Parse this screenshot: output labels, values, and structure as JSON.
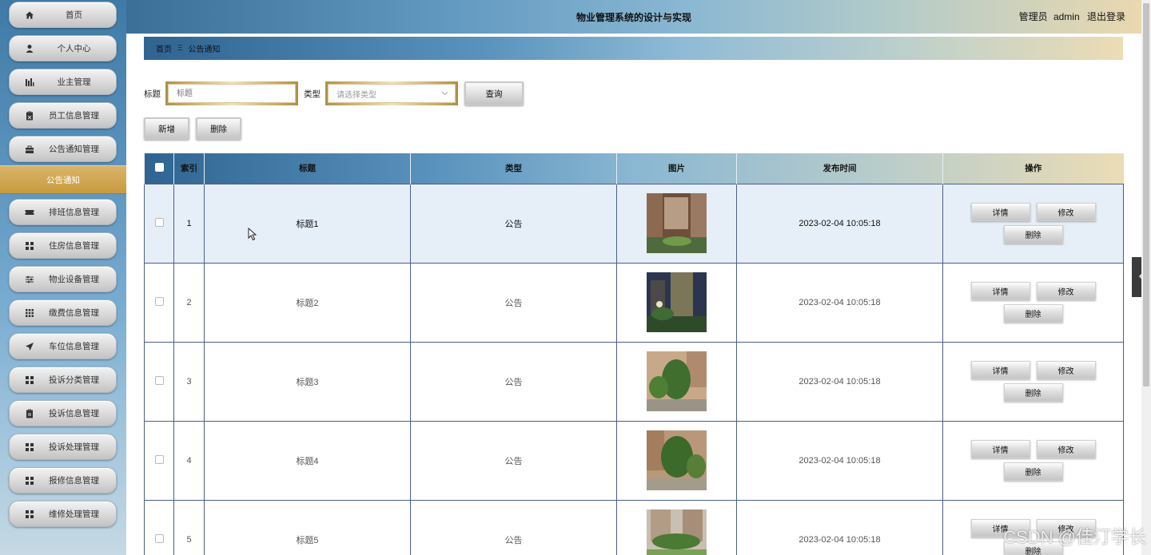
{
  "sidebar": {
    "items": [
      {
        "label": "首页",
        "icon": "home-icon"
      },
      {
        "label": "个人中心",
        "icon": "user-icon"
      },
      {
        "label": "业主管理",
        "icon": "chart-icon"
      },
      {
        "label": "员工信息管理",
        "icon": "clipboard-icon"
      },
      {
        "label": "公告通知管理",
        "icon": "briefcase-icon"
      },
      {
        "label": "排班信息管理",
        "icon": "ticket-icon"
      },
      {
        "label": "住房信息管理",
        "icon": "grid-icon"
      },
      {
        "label": "物业设备管理",
        "icon": "sliders-icon"
      },
      {
        "label": "缴费信息管理",
        "icon": "grid-dots-icon"
      },
      {
        "label": "车位信息管理",
        "icon": "send-icon"
      },
      {
        "label": "投诉分类管理",
        "icon": "grid-icon"
      },
      {
        "label": "投诉信息管理",
        "icon": "clipboard-icon"
      },
      {
        "label": "投诉处理管理",
        "icon": "grid-icon"
      },
      {
        "label": "报修信息管理",
        "icon": "grid-icon"
      },
      {
        "label": "维修处理管理",
        "icon": "grid-icon"
      }
    ],
    "active_sub": "公告通知"
  },
  "header": {
    "title": "物业管理系统的设计与实现",
    "role": "管理员",
    "username": "admin",
    "logout": "退出登录"
  },
  "breadcrumb": {
    "home": "首页",
    "current": "公告通知"
  },
  "search": {
    "title_label": "标题",
    "title_placeholder": "标题",
    "type_label": "类型",
    "type_placeholder": "请选择类型",
    "query_button": "查询"
  },
  "actions": {
    "add": "新增",
    "delete": "删除"
  },
  "table": {
    "headers": [
      "索引",
      "标题",
      "类型",
      "图片",
      "发布时间",
      "操作"
    ],
    "rows": [
      {
        "index": "1",
        "title": "标题1",
        "type": "公告",
        "time": "2023-02-04 10:05:18"
      },
      {
        "index": "2",
        "title": "标题2",
        "type": "公告",
        "time": "2023-02-04 10:05:18"
      },
      {
        "index": "3",
        "title": "标题3",
        "type": "公告",
        "time": "2023-02-04 10:05:18"
      },
      {
        "index": "4",
        "title": "标题4",
        "type": "公告",
        "time": "2023-02-04 10:05:18"
      },
      {
        "index": "5",
        "title": "标题5",
        "type": "公告",
        "time": "2023-02-04 10:05:18"
      }
    ],
    "op_detail": "详情",
    "op_edit": "修改",
    "op_delete": "删除"
  },
  "watermark": "CSDN @佳汀学长",
  "colors": {
    "accent_blue": "#3b6f98",
    "gold": "#c89a3f",
    "row_highlight": "#e6eef8"
  }
}
